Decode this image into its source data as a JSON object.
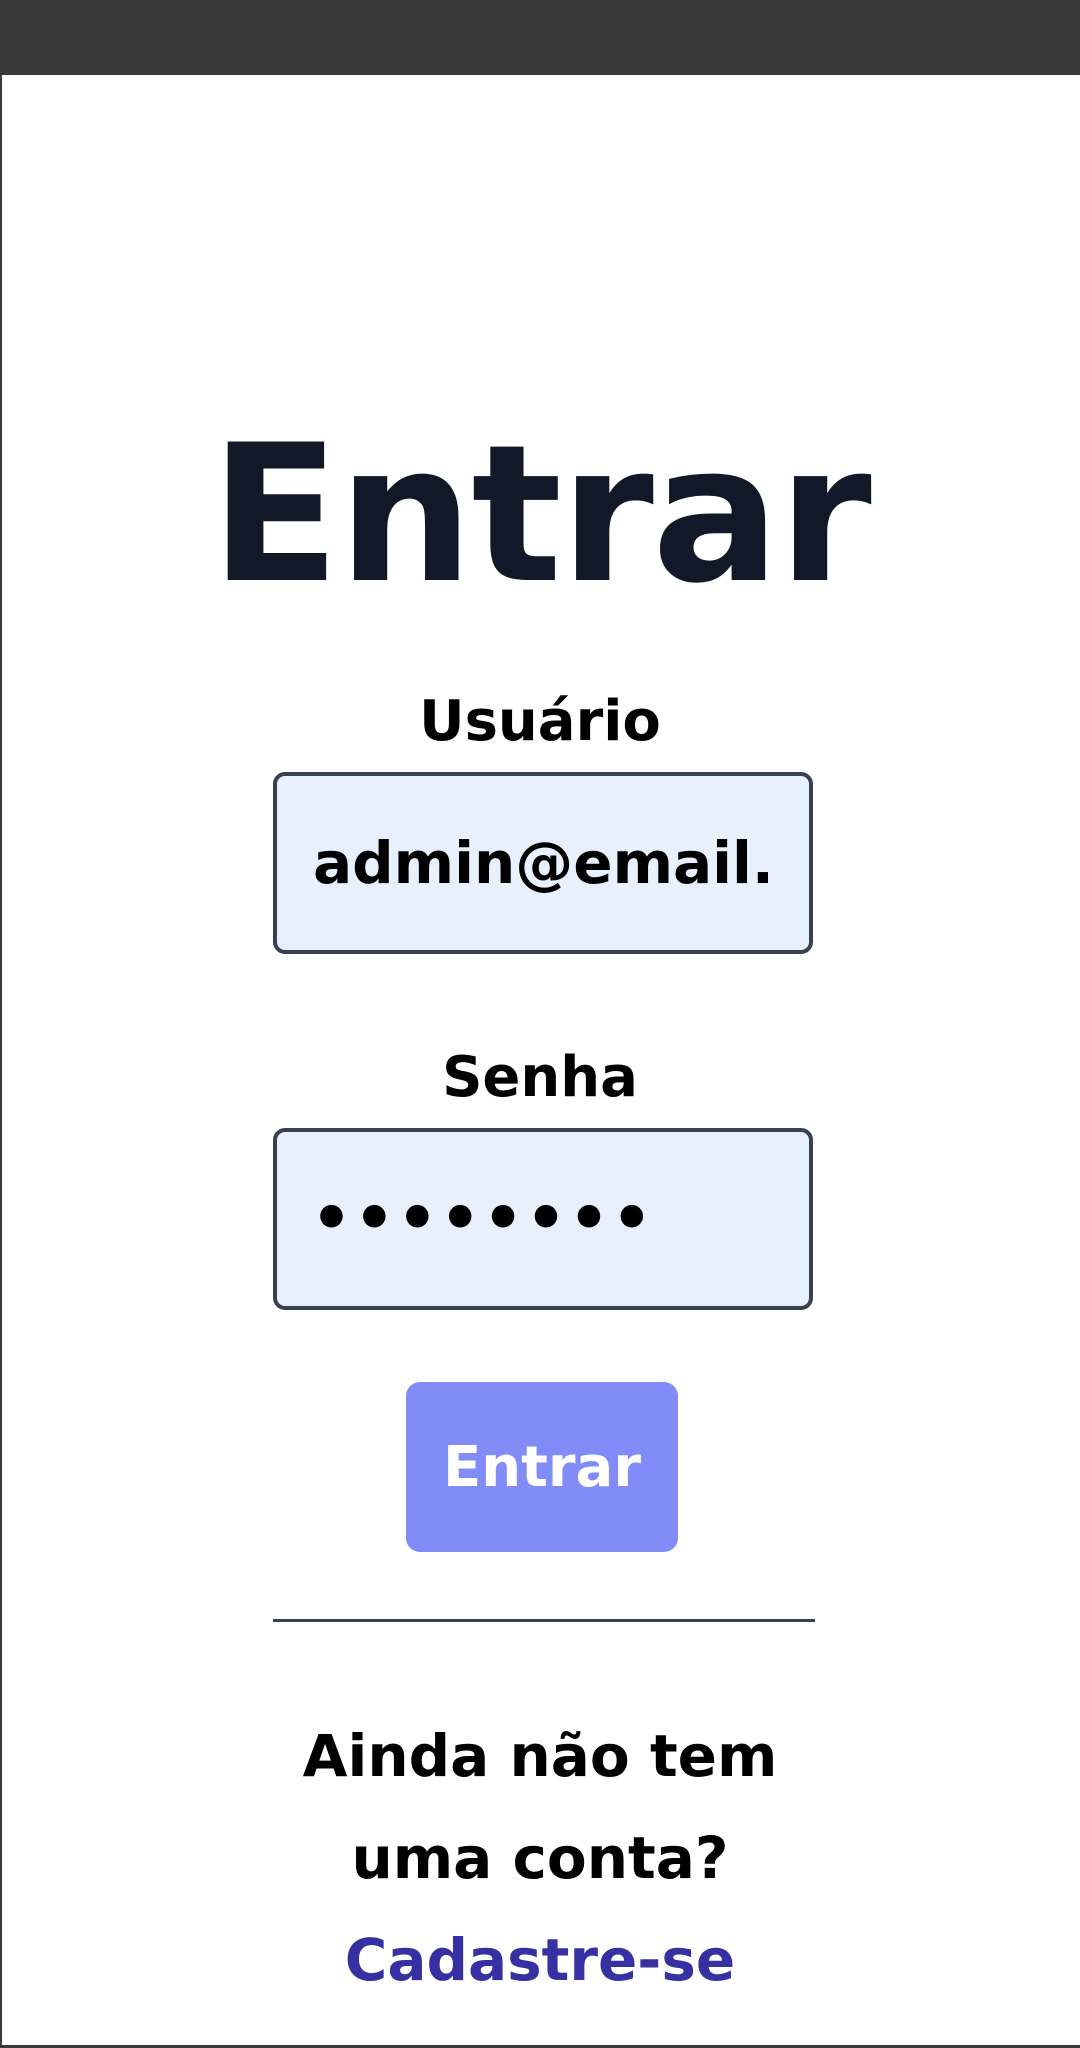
{
  "login": {
    "title": "Entrar",
    "username_label": "Usuário",
    "username_value": "admin@email.",
    "password_label": "Senha",
    "password_value": "••••••••",
    "submit_label": "Entrar",
    "no_account_line1": "Ainda não tem",
    "no_account_line2": "uma conta?",
    "signup_link": "Cadastre-se"
  },
  "colors": {
    "title": "#111827",
    "field_background": "#e8f0fe",
    "field_border": "#374151",
    "button_background": "#818cf8",
    "button_text": "#ffffff",
    "link": "#3730a3",
    "top_bar": "#3a3a3a"
  }
}
